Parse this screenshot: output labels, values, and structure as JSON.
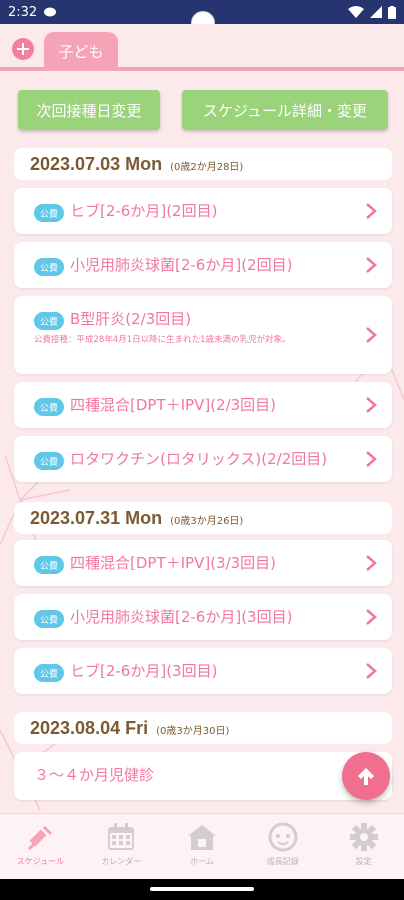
{
  "status": {
    "time": "2:32"
  },
  "header": {
    "tab_label": "子ども",
    "add_icon": "plus-circle-icon"
  },
  "actions": {
    "change_day": "次回接種日変更",
    "schedule_detail": "スケジュール詳細・変更"
  },
  "groups": [
    {
      "date": "2023.07.03 Mon",
      "age": "(0歳2か月28日)",
      "items": [
        {
          "badge": "公費",
          "title": "ヒブ[2-6か月](2回目)"
        },
        {
          "badge": "公費",
          "title": "小児用肺炎球菌[2-6か月](2回目)"
        },
        {
          "badge": "公費",
          "title": "B型肝炎(2/3回目)",
          "note": "公費接種：平成28年4月1日以降に生まれた1歳未満の乳児が対象。"
        },
        {
          "badge": "公費",
          "title": "四種混合[DPT＋IPV](2/3回目)"
        },
        {
          "badge": "公費",
          "title": "ロタワクチン(ロタリックス)(2/2回目)"
        }
      ]
    },
    {
      "date": "2023.07.31 Mon",
      "age": "(0歳3か月26日)",
      "items": [
        {
          "badge": "公費",
          "title": "四種混合[DPT＋IPV](3/3回目)"
        },
        {
          "badge": "公費",
          "title": "小児用肺炎球菌[2-6か月](3回目)"
        },
        {
          "badge": "公費",
          "title": "ヒブ[2-6か月](3回目)"
        }
      ]
    },
    {
      "date": "2023.08.04 Fri",
      "age": "(0歳3か月30日)",
      "items": [
        {
          "title": "３～４か月児健診"
        }
      ]
    }
  ],
  "nav": [
    {
      "label": "スケジュール",
      "icon": "syringe-icon",
      "active": true
    },
    {
      "label": "カレンダー",
      "icon": "calendar-icon"
    },
    {
      "label": "ホーム",
      "icon": "home-icon"
    },
    {
      "label": "成長記録",
      "icon": "baby-face-icon"
    },
    {
      "label": "設定",
      "icon": "gear-icon"
    }
  ],
  "colors": {
    "accent": "#f0789b",
    "tab": "#f5a3b7",
    "button": "#9bd37a",
    "badge": "#5fc7e8",
    "date": "#7b5a33"
  }
}
